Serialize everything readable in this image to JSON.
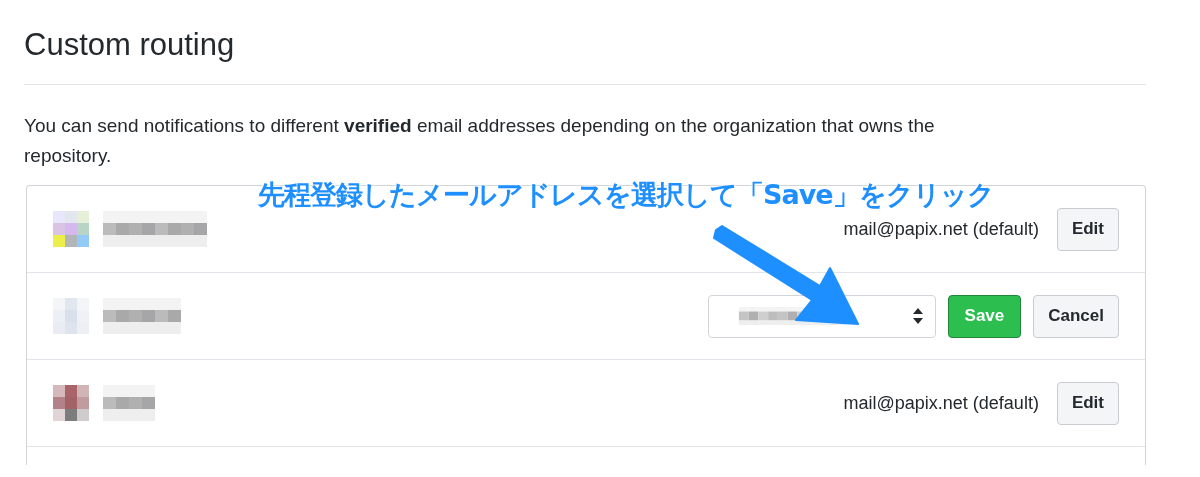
{
  "heading": "Custom routing",
  "description": "You can send notifications to different **verified** email addresses depending on the organization that owns the repository.",
  "annotation": "先程登録したメールアドレスを選択して「Save」をクリック",
  "rows": [
    {
      "kind": "view",
      "email": "mail@papix.net (default)",
      "buttons": [
        "Edit"
      ]
    },
    {
      "kind": "edit",
      "buttons": [
        "Save",
        "Cancel"
      ]
    },
    {
      "kind": "view",
      "email": "mail@papix.net (default)",
      "buttons": [
        "Edit"
      ]
    }
  ]
}
